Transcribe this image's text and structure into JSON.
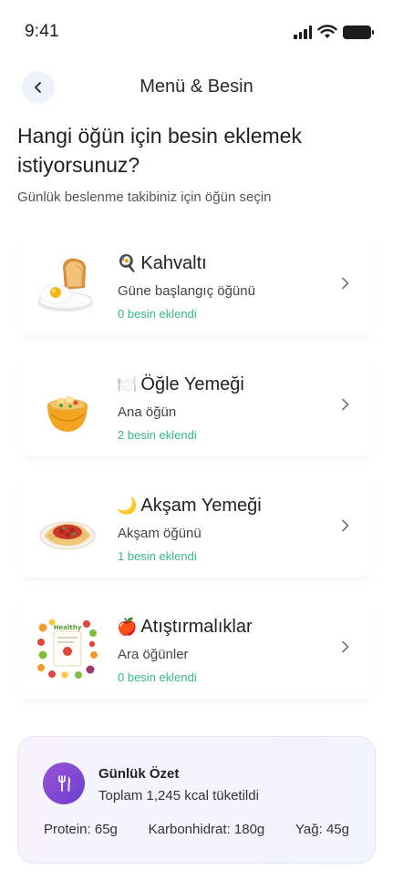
{
  "status_bar": {
    "time": "9:41",
    "icons": [
      "signal-icon",
      "wifi-icon",
      "battery-icon"
    ]
  },
  "header": {
    "title": "Menü & Besin",
    "back_icon": "chevron-left-icon"
  },
  "question": "Hangi öğün için besin eklemek istiyorsunuz?",
  "subtitle": "Günlük beslenme takibiniz için öğün seçin",
  "meals": [
    {
      "emoji": "🍳",
      "title": "Kahvaltı",
      "description": "Güne başlangıç öğünü",
      "count_text": "0 besin eklendi",
      "image": "toast-and-egg-icon"
    },
    {
      "emoji": "🍽️",
      "title": "Öğle Yemeği",
      "description": "Ana öğün",
      "count_text": "2 besin eklendi",
      "image": "soup-bowl-icon"
    },
    {
      "emoji": "🌙",
      "title": "Akşam Yemeği",
      "description": "Akşam öğünü",
      "count_text": "1 besin eklendi",
      "image": "pasta-plate-icon"
    },
    {
      "emoji": "🍎",
      "title": "Atıştırmalıklar",
      "description": "Ara öğünler",
      "count_text": "0 besin eklendi",
      "image": "healthy-snacks-icon",
      "image_text": "Healthy"
    }
  ],
  "summary": {
    "title": "Günlük Özet",
    "total": "Toplam 1,245 kcal tüketildi",
    "protein": "Protein: 65g",
    "carbs": "Karbonhidrat: 180g",
    "fat": "Yağ: 45g",
    "icon": "fork-knife-icon"
  },
  "colors": {
    "accent_green": "#35b88c",
    "accent_purple": "#7b45d4",
    "back_button_bg": "#eef2fa"
  }
}
